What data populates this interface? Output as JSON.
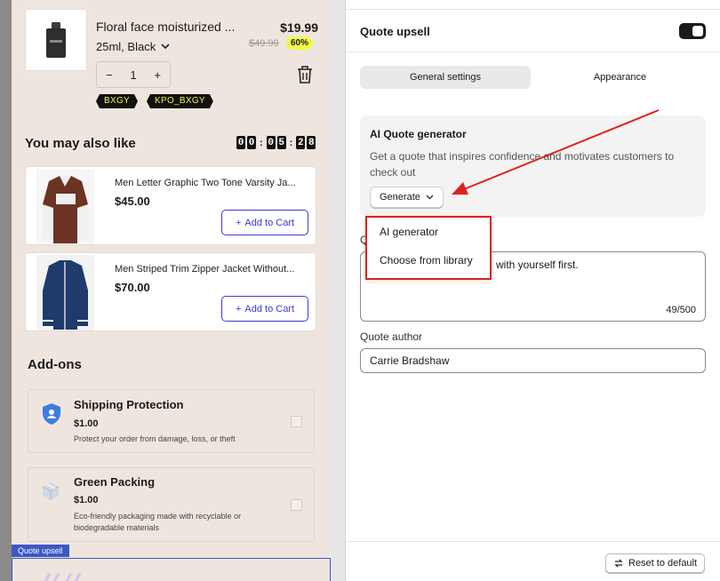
{
  "cart": {
    "product": {
      "title": "Floral face moisturized ...",
      "variant": "25ml, Black",
      "price": "$19.99",
      "old_price": "$49.99",
      "discount": "60%",
      "quantity": "1",
      "qty_minus": "−",
      "qty_plus": "+"
    },
    "discount_codes": [
      "BXGY",
      "KPO_BXGY"
    ],
    "also_like": {
      "title": "You may also like",
      "timer": [
        "0",
        "0",
        "0",
        "5",
        "2",
        "8"
      ],
      "items": [
        {
          "name": "Men Letter Graphic Two Tone Varsity Ja...",
          "price": "$45.00",
          "button": "Add to Cart"
        },
        {
          "name": "Men Striped Trim Zipper Jacket Without...",
          "price": "$70.00",
          "button": "Add to Cart"
        }
      ]
    },
    "addons": {
      "title": "Add-ons",
      "items": [
        {
          "title": "Shipping Protection",
          "price": "$1.00",
          "desc": "Protect your order from damage, loss, or theft",
          "icon": "shield-icon"
        },
        {
          "title": "Green Packing",
          "price": "$1.00",
          "desc": "Eco-friendly packaging made with recyclable or biodegradable materials",
          "icon": "package-icon"
        }
      ]
    },
    "quote_preview_tag": "Quote upsell"
  },
  "settings": {
    "title": "Quote upsell",
    "toggle_on": true,
    "tabs": [
      "General settings",
      "Appearance"
    ],
    "ai": {
      "title": "AI Quote generator",
      "desc": "Get a quote that inspires confidence and motivates customers to check out",
      "button": "Generate"
    },
    "quote_label": "Q",
    "quote_text_visible": "with yourself first.",
    "quote_count": "49/500",
    "author_label": "Quote author",
    "author_value": "Carrie Bradshaw",
    "dropdown": [
      "AI generator",
      "Choose from library"
    ],
    "reset": "Reset to default"
  },
  "colors": {
    "accent": "#3b3bd0",
    "annotation": "#e02020",
    "cart_bg": "#efe5df",
    "badge": "#f1f84a"
  }
}
